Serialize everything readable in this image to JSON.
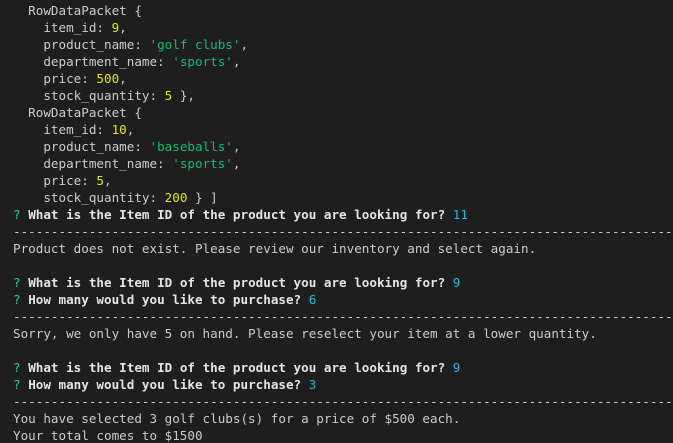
{
  "colors": {
    "background": "#1e1e1e",
    "text": "#cccccc",
    "number": "#e5e510",
    "string": "#0dbc79",
    "prompt_marker": "#23d18b",
    "answer": "#29b8db"
  },
  "records": [
    {
      "open": "  RowDataPacket {",
      "item_id": "9",
      "product_name": "'golf clubs'",
      "department_name": "'sports'",
      "price": "500",
      "stock_quantity": "5",
      "close": " },"
    },
    {
      "open": "  RowDataPacket {",
      "item_id": "10",
      "product_name": "'baseballs'",
      "department_name": "'sports'",
      "price": "5",
      "stock_quantity": "200",
      "close": " } ]"
    }
  ],
  "prompt_marker": "?",
  "questions": {
    "item_id": "What is the Item ID of the product you are looking for?",
    "quantity": "How many would you like to purchase?"
  },
  "answers": {
    "first_item": "11",
    "second_item": "9",
    "second_qty": "6",
    "third_item": "9",
    "third_qty": "3"
  },
  "separator": "------------------------------------------------------------------------------------------------------------",
  "messages": {
    "not_exist": "Product does not exist. Please review our inventory and select again.",
    "insufficient": "Sorry, we only have 5 on hand. Please reselect your item at a lower quantity.",
    "selected": "You have selected 3 golf clubs(s) for a price of $500 each.",
    "total": "Your total comes to $1500"
  }
}
